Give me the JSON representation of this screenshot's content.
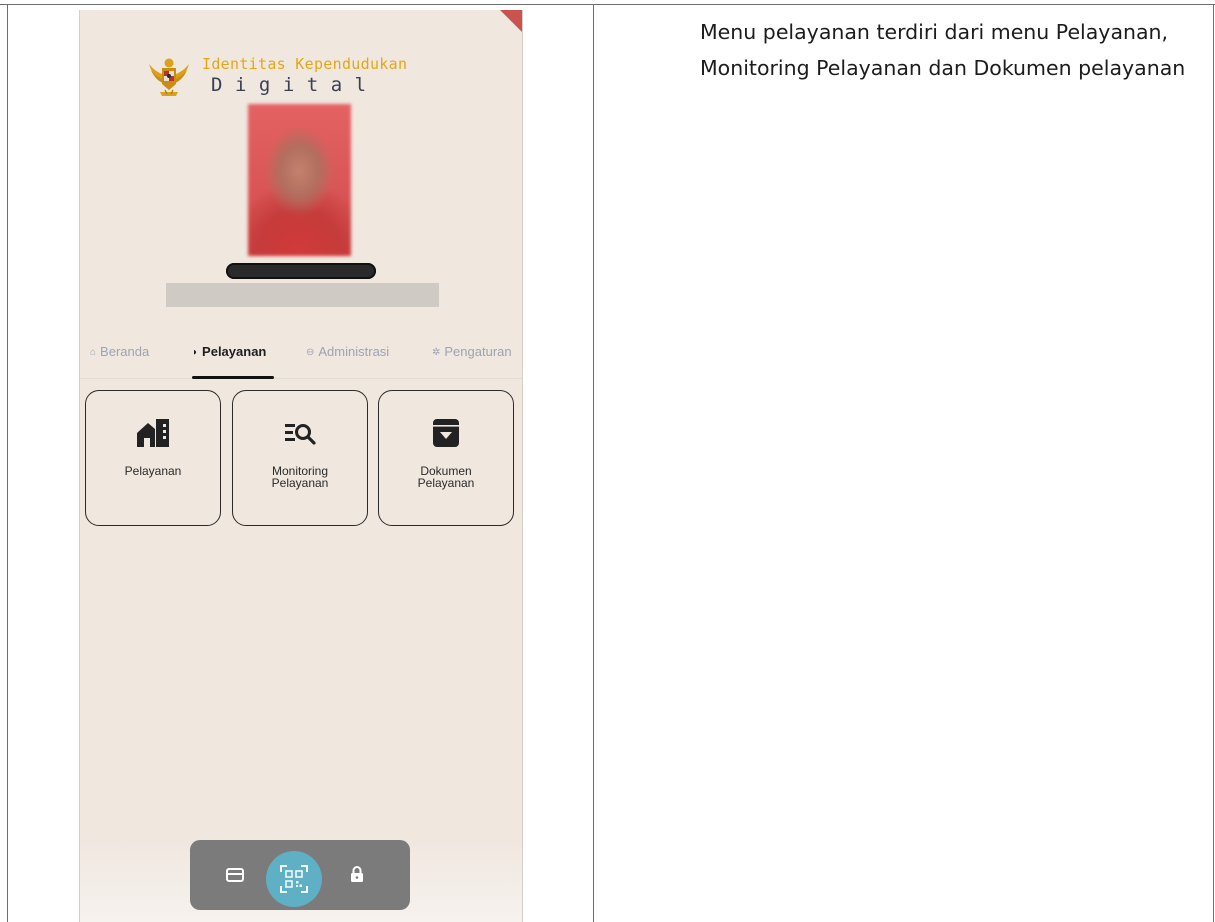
{
  "document": {
    "description": "Menu pelayanan terdiri dari menu Pelayanan, Monitoring Pelayanan dan Dokumen pelayanan"
  },
  "app": {
    "title": "Identitas Kependudukan",
    "subtitle": "Digital",
    "colors": {
      "title": "#e5a719",
      "subtitle": "#3a4054",
      "background": "#f0e7df",
      "qr_button": "#5fb0c4",
      "bottom_nav": "#7b7b7b"
    }
  },
  "tabs": [
    {
      "label": "Beranda",
      "icon": "home-icon",
      "glyph": "⌂",
      "active": false
    },
    {
      "label": "Pelayanan",
      "icon": "service-icon",
      "glyph": "◗",
      "active": true
    },
    {
      "label": "Administrasi",
      "icon": "user-circle-icon",
      "glyph": "⊖",
      "active": false
    },
    {
      "label": "Pengaturan",
      "icon": "gear-icon",
      "glyph": "✲",
      "active": false
    }
  ],
  "menu": [
    {
      "label": "Pelayanan",
      "icon": "building-icon"
    },
    {
      "label": "Monitoring Pelayanan",
      "icon": "list-search-icon"
    },
    {
      "label": "Dokumen Pelayanan",
      "icon": "archive-download-icon"
    }
  ],
  "bottom_nav": [
    {
      "icon": "card-icon"
    },
    {
      "icon": "qr-scan-icon"
    },
    {
      "icon": "lock-icon"
    }
  ]
}
